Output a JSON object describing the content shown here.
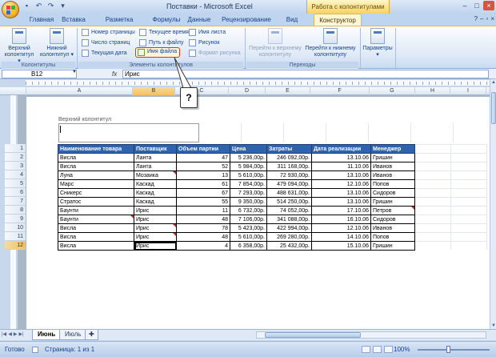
{
  "window": {
    "title": "Поставки - Microsoft Excel",
    "context_tab_title": "Работа с колонтитулами"
  },
  "qat_icons": [
    "save-icon",
    "undo-icon",
    "redo-icon",
    "customize-icon"
  ],
  "window_controls": {
    "minimize": "–",
    "maximize": "□",
    "close": "×"
  },
  "tabs": [
    {
      "label": "Главная"
    },
    {
      "label": "Вставка"
    },
    {
      "label": "Разметка страницы"
    },
    {
      "label": "Формулы"
    },
    {
      "label": "Данные"
    },
    {
      "label": "Рецензирование"
    },
    {
      "label": "Вид"
    },
    {
      "label": "Конструктор"
    }
  ],
  "ribbon": {
    "groups": {
      "headers_footers": "Колонтитулы",
      "elements": "Элементы колонтитулов",
      "navigation": "Переходы"
    },
    "header_btn": {
      "line1": "Верхний",
      "line2": "колонтитул ▾"
    },
    "footer_btn": {
      "line1": "Нижний",
      "line2": "колонтитул ▾"
    },
    "page_number": "Номер страницы",
    "page_count": "Число страниц",
    "current_date": "Текущая дата",
    "current_time": "Текущее время",
    "file_path": "Путь к файлу",
    "file_name": "Имя файла",
    "sheet_name": "Имя листа",
    "picture": "Рисунок",
    "picture_format": "Формат рисунка",
    "goto_header": {
      "line1": "Перейти к верхнему",
      "line2": "колонтитулу"
    },
    "goto_footer": {
      "line1": "Перейти к нижнему",
      "line2": "колонтитулу"
    },
    "options": {
      "line1": "Параметры",
      "line2": "▾"
    }
  },
  "callout_text": "?",
  "formula_bar": {
    "name_box": "B12",
    "fx": "fx",
    "value": "Ирис"
  },
  "columns": [
    "A",
    "B",
    "C",
    "D",
    "E",
    "F",
    "G",
    "H",
    "I"
  ],
  "rows": [
    "1",
    "2",
    "3",
    "4",
    "5",
    "6",
    "7",
    "8",
    "9",
    "10",
    "11",
    "12"
  ],
  "header_area_label": "Верхний колонтитул",
  "table": {
    "headers": [
      "Наименование товара",
      "Поставщик",
      "Объем партии",
      "Цена",
      "Затраты",
      "Дата реализации",
      "Менеджер"
    ],
    "rows": [
      [
        "Висла",
        "Ланта",
        "47",
        "5 236,00р.",
        "246 092,00р.",
        "13.10.06",
        "Гришин"
      ],
      [
        "Висла",
        "Ланта",
        "52",
        "5 984,00р.",
        "311 168,00р.",
        "11.10.06",
        "Иванов"
      ],
      [
        "Луна",
        "Мозаика",
        "13",
        "5 610,00р.",
        "72 930,00р.",
        "13.10.06",
        "Иванов"
      ],
      [
        "Марс",
        "Каскад",
        "61",
        "7 854,00р.",
        "479 094,00р.",
        "12.10.06",
        "Попов"
      ],
      [
        "Сникерс",
        "Каскад",
        "67",
        "7 293,00р.",
        "488 631,00р.",
        "13.10.06",
        "Сидоров"
      ],
      [
        "Стратос",
        "Каскад",
        "55",
        "9 350,00р.",
        "514 250,00р.",
        "13.10.06",
        "Гришин"
      ],
      [
        "Баунти",
        "Ирис",
        "11",
        "6 732,00р.",
        "74 052,00р.",
        "17.10.06",
        "Петров"
      ],
      [
        "Баунти",
        "Ирис",
        "48",
        "7 106,00р.",
        "341 088,00р.",
        "16.10.06",
        "Сидоров"
      ],
      [
        "Висла",
        "Ирис",
        "78",
        "5 423,00р.",
        "422 994,00р.",
        "12.10.06",
        "Иванов"
      ],
      [
        "Висла",
        "Ирис",
        "48",
        "5 610,00р.",
        "269 280,00р.",
        "14.10.06",
        "Попов"
      ],
      [
        "Висла",
        "Ирис",
        "4",
        "6 358,00р.",
        "25 432,00р.",
        "15.10.06",
        "Гришин"
      ]
    ]
  },
  "sheets": [
    {
      "label": "Июнь"
    },
    {
      "label": "Июль"
    }
  ],
  "status": {
    "ready": "Готово",
    "page": "Страница: 1 из 1",
    "zoom": "100%"
  }
}
